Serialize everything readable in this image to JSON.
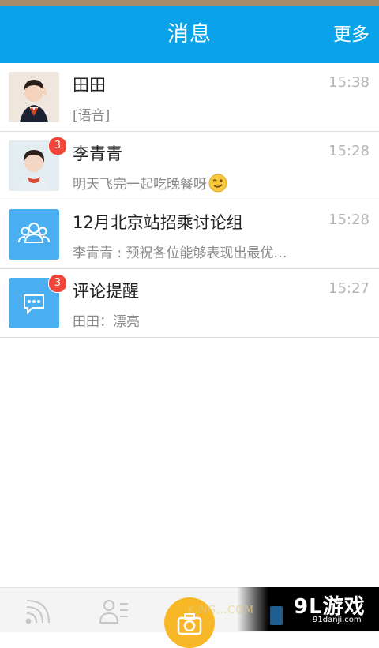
{
  "header": {
    "title": "消息",
    "more_label": "更多"
  },
  "conversations": [
    {
      "name": "田田",
      "time": "15:38",
      "preview": "[语音]",
      "badge": ""
    },
    {
      "name": "李青青",
      "time": "15:28",
      "preview": "明天飞完一起吃晚餐呀",
      "badge": "3"
    },
    {
      "name": "12月北京站招乘讨论组",
      "time": "15:28",
      "preview": "李青青 : 预祝各位能够表现出最优…",
      "badge": ""
    },
    {
      "name": "评论提醒",
      "time": "15:27",
      "preview": "田田：漂亮",
      "badge": "3"
    }
  ],
  "tabbar": {
    "tabs": [
      "feed-icon",
      "contacts-icon",
      "camera-icon",
      "app-icon"
    ]
  },
  "watermark": {
    "brand": "9L游戏",
    "site": "91danji.com",
    "faint": "KING…COM"
  }
}
